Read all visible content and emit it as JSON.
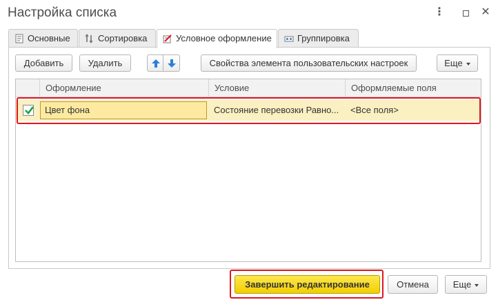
{
  "window": {
    "title": "Настройка списка",
    "menu_glyph": "⋮",
    "close_glyph": "✕"
  },
  "tabs": [
    {
      "label": "Основные",
      "icon": "list-icon",
      "active": false
    },
    {
      "label": "Сортировка",
      "icon": "sort-icon",
      "active": false
    },
    {
      "label": "Условное оформление",
      "icon": "conditional-format-icon",
      "active": true
    },
    {
      "label": "Группировка",
      "icon": "grouping-icon",
      "active": false
    }
  ],
  "toolbar": {
    "add_label": "Добавить",
    "delete_label": "Удалить",
    "move_up_icon": "arrow-up-icon",
    "move_down_icon": "arrow-down-icon",
    "properties_label": "Свойства элемента пользовательских настроек",
    "more_label": "Еще"
  },
  "table": {
    "columns": [
      "Оформление",
      "Условие",
      "Оформляемые поля"
    ],
    "rows": [
      {
        "checked": true,
        "appearance": "Цвет фона",
        "condition": "Состояние перевозки Равно...",
        "fields": "<Все поля>"
      }
    ]
  },
  "footer": {
    "finish_label": "Завершить редактирование",
    "cancel_label": "Отмена",
    "more_label": "Еще"
  },
  "colors": {
    "highlight": "#e0161e",
    "primary_button": "#f7dc1e",
    "selected_row": "#fbf0c2",
    "check": "#1aa34a",
    "arrow": "#2b7fd6"
  }
}
